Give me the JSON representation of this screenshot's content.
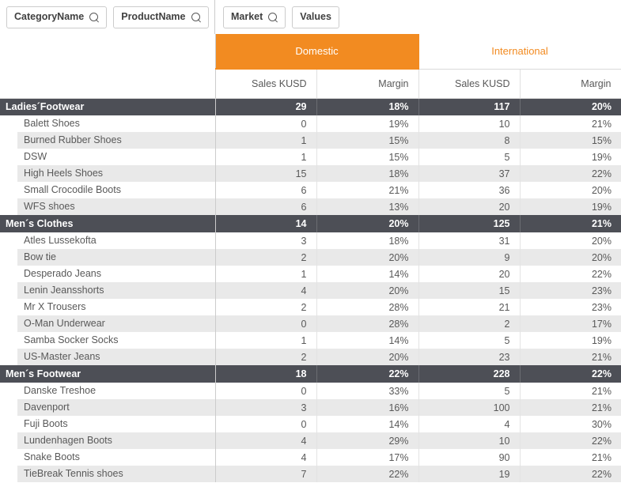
{
  "filters": {
    "left": [
      {
        "label": "CategoryName",
        "icon": "search-icon",
        "has_search": true
      },
      {
        "label": "ProductName",
        "icon": "search-icon",
        "has_search": true
      }
    ],
    "right": [
      {
        "label": "Market",
        "icon": "search-icon",
        "has_search": true
      },
      {
        "label": "Values",
        "icon": "",
        "has_search": false
      }
    ]
  },
  "colors": {
    "accent": "#f28b21",
    "group_row_bg": "#4d4f56",
    "stripe_bg": "#e9e9e9",
    "text": "#595959"
  },
  "table": {
    "markets": [
      {
        "label": "Domestic",
        "selected": true
      },
      {
        "label": "International",
        "selected": false
      }
    ],
    "measures": [
      "Sales KUSD",
      "Margin",
      "Sales KUSD",
      "Margin"
    ],
    "groups": [
      {
        "name": "Ladies´Footwear",
        "totals": [
          "29",
          "18%",
          "117",
          "20%"
        ],
        "rows": [
          {
            "name": "Balett Shoes",
            "values": [
              "0",
              "19%",
              "10",
              "21%"
            ]
          },
          {
            "name": "Burned Rubber Shoes",
            "values": [
              "1",
              "15%",
              "8",
              "15%"
            ]
          },
          {
            "name": "DSW",
            "values": [
              "1",
              "15%",
              "5",
              "19%"
            ]
          },
          {
            "name": "High Heels Shoes",
            "values": [
              "15",
              "18%",
              "37",
              "22%"
            ]
          },
          {
            "name": "Small Crocodile Boots",
            "values": [
              "6",
              "21%",
              "36",
              "20%"
            ]
          },
          {
            "name": "WFS shoes",
            "values": [
              "6",
              "13%",
              "20",
              "19%"
            ]
          }
        ]
      },
      {
        "name": "Men´s Clothes",
        "totals": [
          "14",
          "20%",
          "125",
          "21%"
        ],
        "rows": [
          {
            "name": "Atles Lussekofta",
            "values": [
              "3",
              "18%",
              "31",
              "20%"
            ]
          },
          {
            "name": "Bow tie",
            "values": [
              "2",
              "20%",
              "9",
              "20%"
            ]
          },
          {
            "name": "Desperado Jeans",
            "values": [
              "1",
              "14%",
              "20",
              "22%"
            ]
          },
          {
            "name": "Lenin Jeansshorts",
            "values": [
              "4",
              "20%",
              "15",
              "23%"
            ]
          },
          {
            "name": "Mr X Trousers",
            "values": [
              "2",
              "28%",
              "21",
              "23%"
            ]
          },
          {
            "name": "O-Man Underwear",
            "values": [
              "0",
              "28%",
              "2",
              "17%"
            ]
          },
          {
            "name": "Samba Socker Socks",
            "values": [
              "1",
              "14%",
              "5",
              "19%"
            ]
          },
          {
            "name": "US-Master Jeans",
            "values": [
              "2",
              "20%",
              "23",
              "21%"
            ]
          }
        ]
      },
      {
        "name": "Men´s Footwear",
        "totals": [
          "18",
          "22%",
          "228",
          "22%"
        ],
        "rows": [
          {
            "name": "Danske Treshoe",
            "values": [
              "0",
              "33%",
              "5",
              "21%"
            ]
          },
          {
            "name": "Davenport",
            "values": [
              "3",
              "16%",
              "100",
              "21%"
            ]
          },
          {
            "name": "Fuji Boots",
            "values": [
              "0",
              "14%",
              "4",
              "30%"
            ]
          },
          {
            "name": "Lundenhagen Boots",
            "values": [
              "4",
              "29%",
              "10",
              "22%"
            ]
          },
          {
            "name": "Snake Boots",
            "values": [
              "4",
              "17%",
              "90",
              "21%"
            ]
          },
          {
            "name": "TieBreak Tennis shoes",
            "values": [
              "7",
              "22%",
              "19",
              "22%"
            ]
          }
        ]
      }
    ]
  }
}
